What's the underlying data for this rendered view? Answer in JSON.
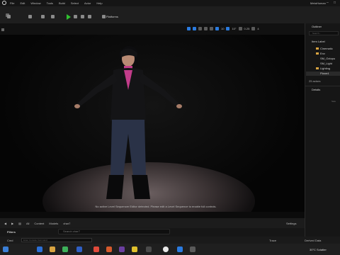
{
  "title_bar": {
    "menu": [
      "File",
      "Edit",
      "Window",
      "Tools",
      "Build",
      "Select",
      "Actor",
      "Help"
    ],
    "app_title": "MetaHuman"
  },
  "toolbar": {
    "platforms_label": "Platforms",
    "play_icon": "play-icon"
  },
  "viewport_bar": {
    "numbers": [
      "10",
      "10°",
      "0.25",
      "4"
    ]
  },
  "viewport": {
    "message": "No active Level Sequencer Editor detected. Please edit a Level Sequence to enable full controls."
  },
  "content_browser": {
    "breadcrumb": [
      "All",
      "Content",
      "Models",
      "char7"
    ],
    "settings_label": "Settings",
    "filters_label": "Filters",
    "search_placeholder": "Search char7"
  },
  "console": {
    "cmd_label": "Cmd",
    "cmd_placeholder": "Enter Console Command",
    "trace_label": "Trace",
    "derived_label": "Derived Data"
  },
  "outliner": {
    "title": "Outliner",
    "search_placeholder": "Search...",
    "header": "Item Label",
    "rows": [
      {
        "label": "Cinematic",
        "indent": 2,
        "folder": true
      },
      {
        "label": "Env",
        "indent": 2,
        "folder": true
      },
      {
        "label": "SM_Octopu",
        "indent": 3,
        "folder": false
      },
      {
        "label": "SM_Light",
        "indent": 3,
        "folder": false
      },
      {
        "label": "Lighting",
        "indent": 2,
        "folder": true
      },
      {
        "label": "Plane4",
        "indent": 3,
        "folder": false
      }
    ],
    "actors_count": "25 actors"
  },
  "details": {
    "title": "Details",
    "empty_text": "Sele"
  },
  "taskbar": {
    "weather": "30°C  Sctatter"
  },
  "colors": {
    "play_green": "#2fc12f",
    "accent_blue": "#2a7be0",
    "folder": "#d9a441"
  }
}
